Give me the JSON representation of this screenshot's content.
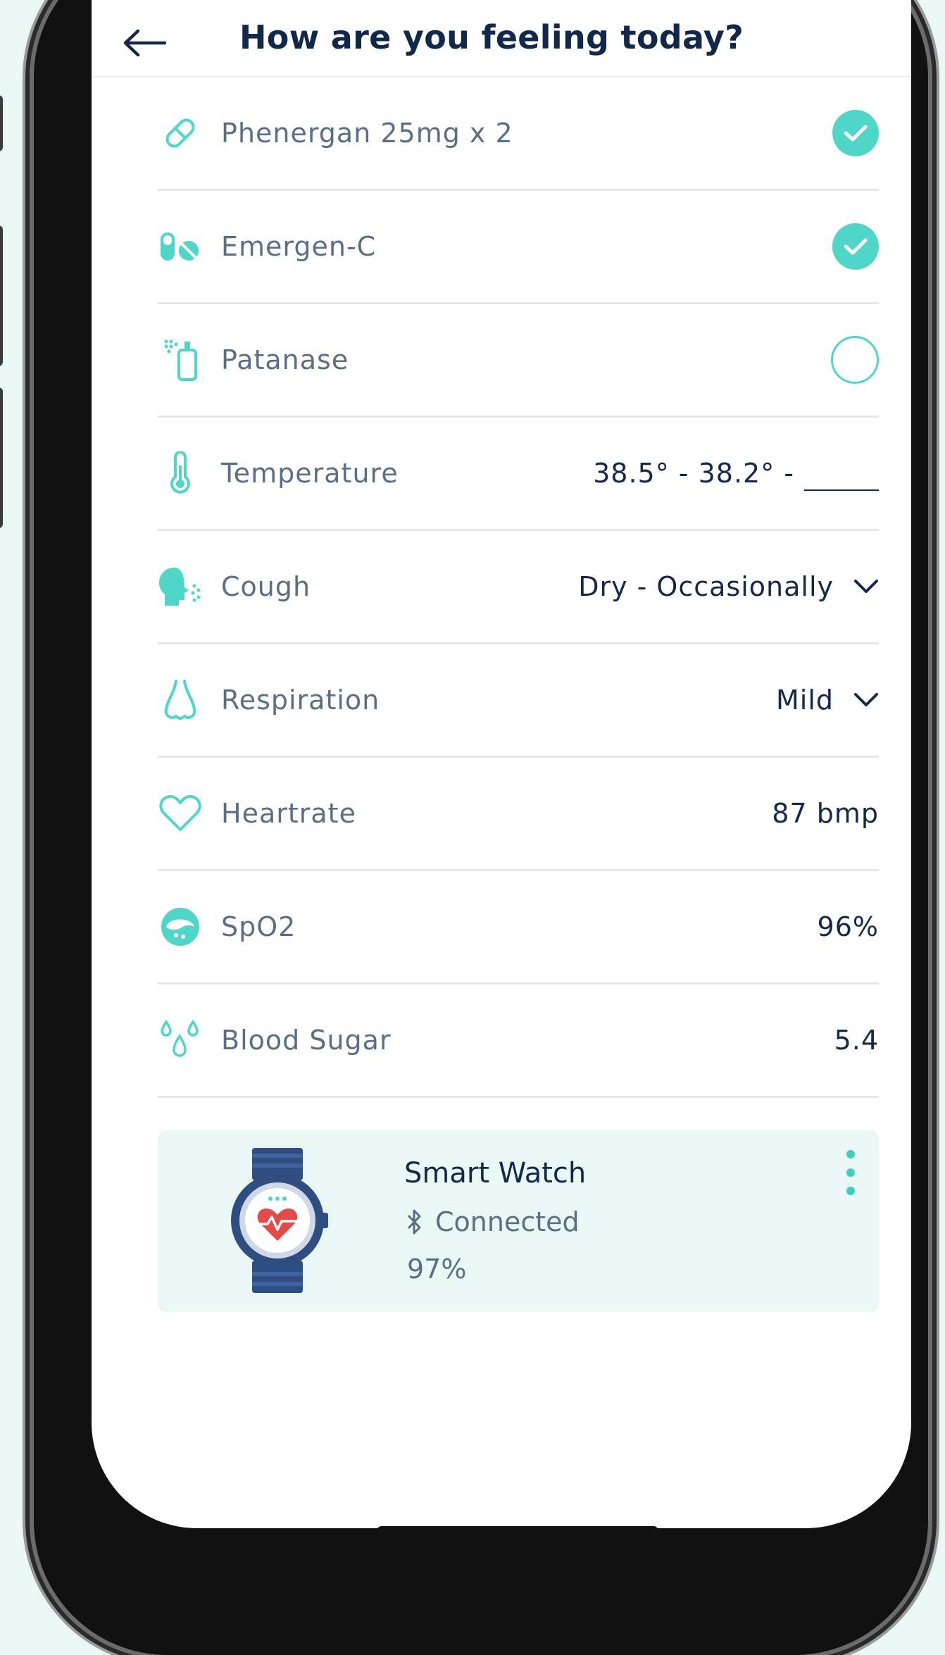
{
  "header": {
    "title": "How are you feeling today?"
  },
  "items": [
    {
      "label": "Phenergan 25mg x 2",
      "icon": "pill-icon",
      "state": "checked"
    },
    {
      "label": "Emergen-C",
      "icon": "vitamin-icon",
      "state": "checked"
    },
    {
      "label": "Patanase",
      "icon": "spray-icon",
      "state": "unchecked"
    },
    {
      "label": "Temperature",
      "icon": "thermometer-icon",
      "value": "38.5° - 38.2° -"
    },
    {
      "label": "Cough",
      "icon": "cough-icon",
      "value": "Dry - Occasionally"
    },
    {
      "label": "Respiration",
      "icon": "nose-icon",
      "value": "Mild"
    },
    {
      "label": "Heartrate",
      "icon": "heart-icon",
      "value": "87 bmp"
    },
    {
      "label": "SpO2",
      "icon": "oximeter-icon",
      "value": "96%"
    },
    {
      "label": "Blood Sugar",
      "icon": "droplets-icon",
      "value": "5.4"
    }
  ],
  "device": {
    "name": "Smart Watch",
    "status": "Connected",
    "battery": "97%",
    "icon": "smartwatch-icon"
  },
  "colors": {
    "accent": "#4fd6c9",
    "text_dark": "#14294a",
    "text_muted": "#5b6f84",
    "card_bg": "#e9f8f4"
  }
}
